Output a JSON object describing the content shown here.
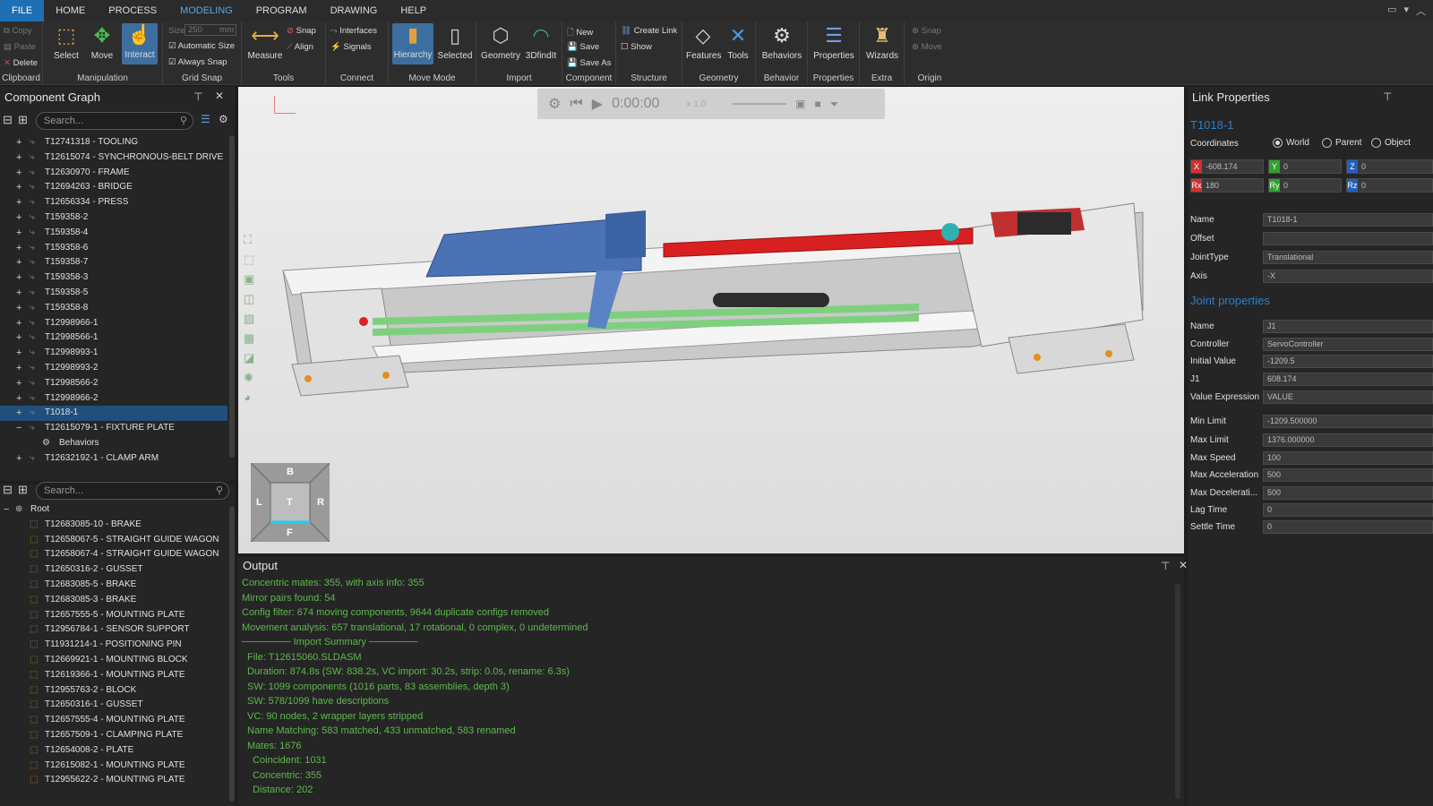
{
  "menu": [
    "FILE",
    "HOME",
    "PROCESS",
    "MODELING",
    "PROGRAM",
    "DRAWING",
    "HELP"
  ],
  "ribbon": {
    "clipboard": {
      "copy": "Copy",
      "paste": "Paste",
      "delete": "Delete",
      "label": "Clipboard"
    },
    "manipulation": {
      "select": "Select",
      "move": "Move",
      "interact": "Interact",
      "label": "Manipulation"
    },
    "grid_snap": {
      "size_label": "Size",
      "size_value": "250",
      "size_unit": "mm",
      "automatic_size": "Automatic Size",
      "always_snap": "Always Snap",
      "label": "Grid Snap"
    },
    "tools": {
      "measure": "Measure",
      "snap": "Snap",
      "align": "Align",
      "label": "Tools"
    },
    "connect": {
      "interfaces": "Interfaces",
      "signals": "Signals",
      "label": "Connect"
    },
    "move_mode": {
      "hierarchy": "Hierarchy",
      "selected": "Selected",
      "label": "Move Mode"
    },
    "import": {
      "geometry": "Geometry",
      "fitfit": "3DfindIt",
      "label": "Import"
    },
    "component": {
      "new": "New",
      "save": "Save",
      "save_as": "Save As",
      "label": "Component"
    },
    "structure": {
      "create_link": "Create Link",
      "show": "Show",
      "label": "Structure"
    },
    "geometry": {
      "features": "Features",
      "tools": "Tools",
      "label": "Geometry"
    },
    "behavior": {
      "behaviors": "Behaviors",
      "label": "Behavior"
    },
    "properties": {
      "properties": "Properties",
      "label": "Properties"
    },
    "extra": {
      "wizards": "Wizards",
      "label": "Extra"
    },
    "origin": {
      "snap": "Snap",
      "move": "Move",
      "label": "Origin"
    }
  },
  "component_graph": {
    "title": "Component Graph",
    "search_placeholder": "Search...",
    "items": [
      {
        "label": "T12741318 - TOOLING",
        "sign": "+"
      },
      {
        "label": "T12615074 - SYNCHRONOUS-BELT DRIVE",
        "sign": "+"
      },
      {
        "label": "T12630970 - FRAME",
        "sign": "+"
      },
      {
        "label": "T12694263 - BRIDGE",
        "sign": "+"
      },
      {
        "label": "T12656334 - PRESS",
        "sign": "+"
      },
      {
        "label": "T159358-2",
        "sign": "+"
      },
      {
        "label": "T159358-4",
        "sign": "+"
      },
      {
        "label": "T159358-6",
        "sign": "+"
      },
      {
        "label": "T159358-7",
        "sign": "+"
      },
      {
        "label": "T159358-3",
        "sign": "+"
      },
      {
        "label": "T159358-5",
        "sign": "+"
      },
      {
        "label": "T159358-8",
        "sign": "+"
      },
      {
        "label": "T12998966-1",
        "sign": "+"
      },
      {
        "label": "T12998566-1",
        "sign": "+"
      },
      {
        "label": "T12998993-1",
        "sign": "+"
      },
      {
        "label": "T12998993-2",
        "sign": "+"
      },
      {
        "label": "T12998566-2",
        "sign": "+"
      },
      {
        "label": "T12998966-2",
        "sign": "+"
      },
      {
        "label": "T1018-1",
        "sign": "+",
        "selected": true
      },
      {
        "label": "T12615079-1 - FIXTURE PLATE",
        "sign": "−"
      },
      {
        "label": "Behaviors",
        "sign": "",
        "child": true
      },
      {
        "label": "T12632192-1 - CLAMP ARM",
        "sign": "+"
      }
    ]
  },
  "parts_tree": {
    "search_placeholder": "Search...",
    "root": "Root",
    "items": [
      "T12683085-10 - BRAKE",
      "T12658067-5 - STRAIGHT GUIDE WAGON",
      "T12658067-4 - STRAIGHT GUIDE WAGON",
      "T12650316-2 - GUSSET",
      "T12683085-5 - BRAKE",
      "T12683085-3 - BRAKE",
      "T12657555-5 - MOUNTING PLATE",
      "T12956784-1 - SENSOR SUPPORT",
      "T11931214-1 - POSITIONING PIN",
      "T12669921-1 - MOUNTING BLOCK",
      "T12619366-1 - MOUNTING PLATE",
      "T12955763-2 - BLOCK",
      "T12650316-1 - GUSSET",
      "T12657555-4 - MOUNTING PLATE",
      "T12657509-1 - CLAMPING PLATE",
      "T12654008-2 - PLATE",
      "T12615082-1 - MOUNTING PLATE",
      "T12955622-2 - MOUNTING PLATE"
    ]
  },
  "viewport": {
    "time": "0:00:00",
    "speed": "x 1.0",
    "cube": {
      "top": "B",
      "left": "L",
      "center": "T",
      "right": "R",
      "bottom": "F"
    }
  },
  "output": {
    "title": "Output",
    "lines": [
      "Concentric mates: 355, with axis info: 355",
      "Mirror pairs found: 54",
      "Config filter: 674 moving components, 9644 duplicate configs removed",
      "Movement analysis: 657 translational, 17 rotational, 0 complex, 0 undetermined",
      "─────── Import Summary ───────",
      "File: T12615060.SLDASM",
      "Duration: 874.8s (SW: 838.2s, VC import: 30.2s, strip: 0.0s, rename: 6.3s)",
      "SW: 1099 components (1016 parts, 83 assemblies, depth 3)",
      "SW: 578/1099 have descriptions",
      "VC: 90 nodes, 2 wrapper layers stripped",
      "Name Matching: 583 matched, 433 unmatched, 583 renamed",
      "Mates: 1676",
      "  Coincident: 1031",
      "  Concentric: 355",
      "  Distance: 202"
    ]
  },
  "link_properties": {
    "title": "Link Properties",
    "link_name": "T1018-1",
    "coordinates_label": "Coordinates",
    "coord_options": [
      "World",
      "Parent",
      "Object"
    ],
    "x": "-608.174",
    "y": "0",
    "z": "0",
    "rx": "180",
    "ry": "0",
    "rz": "0",
    "fields": [
      {
        "label": "Name",
        "value": "T1018-1"
      },
      {
        "label": "Offset",
        "value": ""
      },
      {
        "label": "JointType",
        "value": "Translational"
      },
      {
        "label": "Axis",
        "value": "-X"
      }
    ],
    "joint_title": "Joint properties",
    "joint_fields": [
      {
        "label": "Name",
        "value": "J1"
      },
      {
        "label": "Controller",
        "value": "ServoController"
      },
      {
        "label": "Initial Value",
        "value": "-1209.5"
      },
      {
        "label": "J1",
        "value": "608.174"
      },
      {
        "label": "Value Expression",
        "value": "VALUE"
      },
      {
        "label": "Min Limit",
        "value": "-1209.500000"
      },
      {
        "label": "Max Limit",
        "value": "1376.000000"
      },
      {
        "label": "Max Speed",
        "value": "100"
      },
      {
        "label": "Max Acceleration",
        "value": "500"
      },
      {
        "label": "Max Decelerati...",
        "value": "500"
      },
      {
        "label": "Lag Time",
        "value": "0"
      },
      {
        "label": "Settle Time",
        "value": "0"
      }
    ]
  },
  "colors": {
    "accent": "#1e6fb3",
    "link_blue": "#2e7fc4",
    "output_green": "#5fb84c"
  }
}
